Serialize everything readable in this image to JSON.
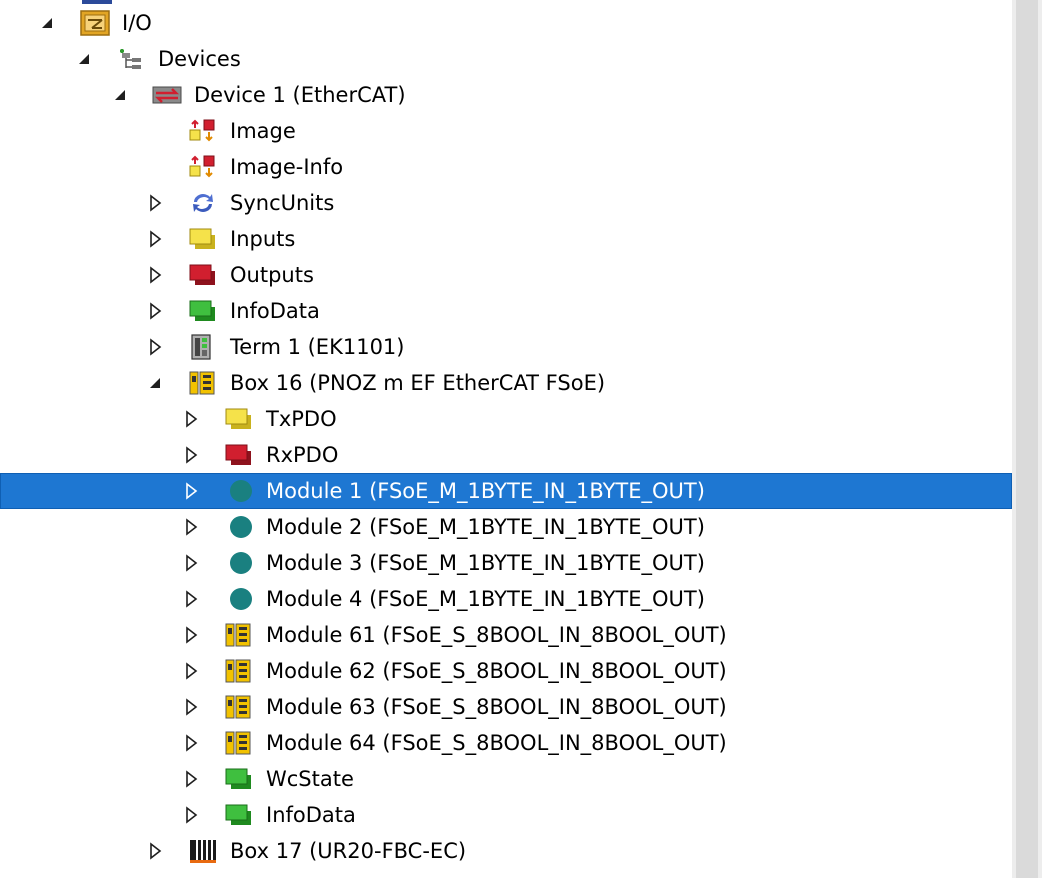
{
  "tree": {
    "items": [
      {
        "label": "I/O",
        "icon": "io-folder-icon",
        "expander": "expanded"
      },
      {
        "label": "Devices",
        "icon": "devices-tree-icon",
        "expander": "expanded"
      },
      {
        "label": "Device 1 (EtherCAT)",
        "icon": "ethercat-device-icon",
        "expander": "expanded"
      },
      {
        "label": "Image",
        "icon": "image-icon",
        "expander": "none"
      },
      {
        "label": "Image-Info",
        "icon": "image-info-icon",
        "expander": "none"
      },
      {
        "label": "SyncUnits",
        "icon": "sync-units-icon",
        "expander": "collapsed"
      },
      {
        "label": "Inputs",
        "icon": "inputs-icon",
        "expander": "collapsed"
      },
      {
        "label": "Outputs",
        "icon": "outputs-icon",
        "expander": "collapsed"
      },
      {
        "label": "InfoData",
        "icon": "infodata-icon",
        "expander": "collapsed"
      },
      {
        "label": "Term 1 (EK1101)",
        "icon": "terminal-coupler-icon",
        "expander": "collapsed"
      },
      {
        "label": "Box 16 (PNOZ m EF EtherCAT FSoE)",
        "icon": "safety-box-icon",
        "expander": "expanded"
      },
      {
        "label": "TxPDO",
        "icon": "txpdo-icon",
        "expander": "collapsed"
      },
      {
        "label": "RxPDO",
        "icon": "rxpdo-icon",
        "expander": "collapsed"
      },
      {
        "label": "Module 1 (FSoE_M_1BYTE_IN_1BYTE_OUT)",
        "icon": "module-dot-icon",
        "expander": "collapsed",
        "selected": true
      },
      {
        "label": "Module 2 (FSoE_M_1BYTE_IN_1BYTE_OUT)",
        "icon": "module-dot-icon",
        "expander": "collapsed"
      },
      {
        "label": "Module 3 (FSoE_M_1BYTE_IN_1BYTE_OUT)",
        "icon": "module-dot-icon",
        "expander": "collapsed"
      },
      {
        "label": "Module 4 (FSoE_M_1BYTE_IN_1BYTE_OUT)",
        "icon": "module-dot-icon",
        "expander": "collapsed"
      },
      {
        "label": "Module 61 (FSoE_S_8BOOL_IN_8BOOL_OUT)",
        "icon": "safety-module-icon",
        "expander": "collapsed"
      },
      {
        "label": "Module 62 (FSoE_S_8BOOL_IN_8BOOL_OUT)",
        "icon": "safety-module-icon",
        "expander": "collapsed"
      },
      {
        "label": "Module 63 (FSoE_S_8BOOL_IN_8BOOL_OUT)",
        "icon": "safety-module-icon",
        "expander": "collapsed"
      },
      {
        "label": "Module 64 (FSoE_S_8BOOL_IN_8BOOL_OUT)",
        "icon": "safety-module-icon",
        "expander": "collapsed"
      },
      {
        "label": "WcState",
        "icon": "wcstate-icon",
        "expander": "collapsed"
      },
      {
        "label": "InfoData",
        "icon": "infodata-icon",
        "expander": "collapsed"
      },
      {
        "label": "Box 17 (UR20-FBC-EC)",
        "icon": "remote-io-box-icon",
        "expander": "collapsed"
      }
    ]
  },
  "colors": {
    "selection": "#1e77d2",
    "module_dot": "#1a8080",
    "input_yellow": "#f5e24a",
    "output_red": "#d11f2f",
    "info_green": "#3fbf3f"
  }
}
